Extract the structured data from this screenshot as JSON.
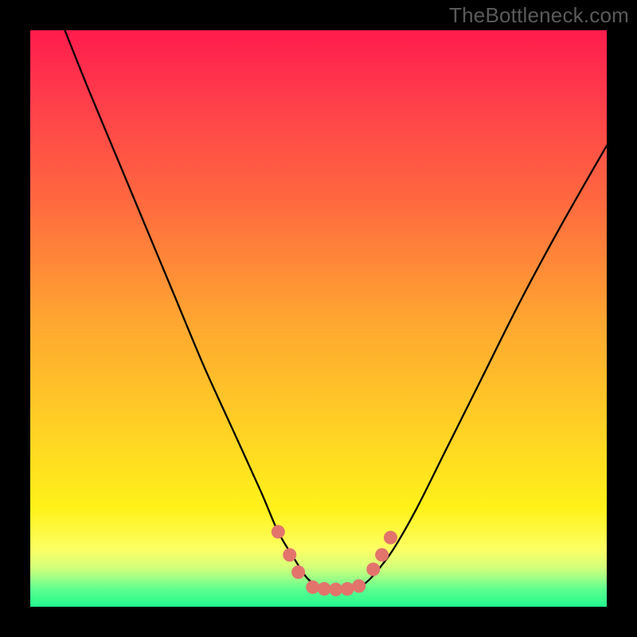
{
  "watermark": "TheBottleneck.com",
  "colors": {
    "frame": "#000000",
    "watermark_text": "#5a5a5a",
    "curve_stroke": "#000000",
    "dot_fill": "#e2746c",
    "gradient_stops": [
      "#ff1c4d",
      "#ff3d4b",
      "#ff6a3f",
      "#ffa531",
      "#ffd324",
      "#fff21a",
      "#fcff63",
      "#d7ff7a",
      "#9fff86",
      "#5cff8f",
      "#21f98e"
    ]
  },
  "chart_data": {
    "type": "line",
    "title": "",
    "xlabel": "",
    "ylabel": "",
    "xlim": [
      0,
      100
    ],
    "ylim": [
      0,
      100
    ],
    "grid": false,
    "legend": false,
    "series": [
      {
        "name": "bottleneck-curve",
        "x": [
          6,
          10,
          15,
          20,
          25,
          30,
          35,
          40,
          43,
          46,
          48,
          50,
          52,
          54,
          56,
          58,
          60,
          63,
          67,
          72,
          78,
          85,
          92,
          100
        ],
        "y": [
          100,
          90,
          78,
          66,
          54,
          42,
          31,
          20,
          13,
          8,
          5,
          3.5,
          3,
          3,
          3.2,
          4,
          6,
          10,
          17,
          27,
          39,
          53,
          66,
          80
        ]
      }
    ],
    "markers": [
      {
        "name": "left-upper-dot",
        "x": 43.0,
        "y": 13.0
      },
      {
        "name": "left-mid-dot",
        "x": 45.0,
        "y": 9.0
      },
      {
        "name": "left-lower-dot",
        "x": 46.5,
        "y": 6.0
      },
      {
        "name": "floor-dot-1",
        "x": 49.0,
        "y": 3.4
      },
      {
        "name": "floor-dot-2",
        "x": 51.0,
        "y": 3.1
      },
      {
        "name": "floor-dot-3",
        "x": 53.0,
        "y": 3.0
      },
      {
        "name": "floor-dot-4",
        "x": 55.0,
        "y": 3.1
      },
      {
        "name": "floor-dot-5",
        "x": 57.0,
        "y": 3.6
      },
      {
        "name": "right-lower-dot",
        "x": 59.5,
        "y": 6.5
      },
      {
        "name": "right-mid-dot",
        "x": 61.0,
        "y": 9.0
      },
      {
        "name": "right-upper-dot",
        "x": 62.5,
        "y": 12.0
      }
    ]
  }
}
